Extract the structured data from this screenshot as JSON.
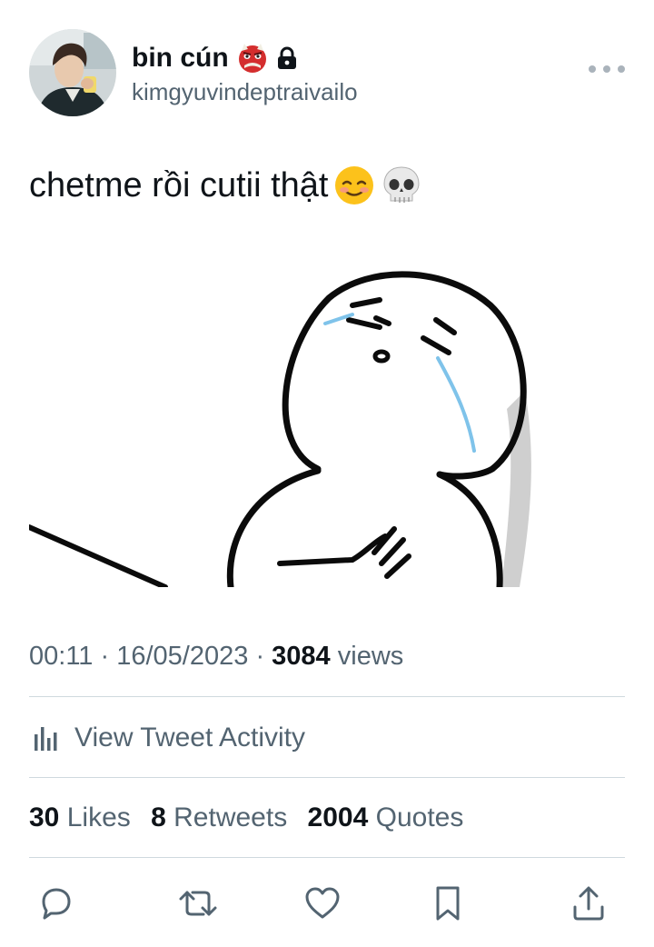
{
  "user": {
    "display_name": "bin cún",
    "handle": "kimgyuvindeptraivailo",
    "badge_icon": "ogre-emoji-icon",
    "protected_icon": "lock-icon"
  },
  "tweet": {
    "text": "chetme rồi cutii thật",
    "emojis": [
      "smiling-face-icon",
      "skull-icon"
    ]
  },
  "meta": {
    "time": "00:11",
    "separator": "·",
    "date": "16/05/2023",
    "views_count": "3084",
    "views_label": "views"
  },
  "activity": {
    "label": "View Tweet Activity"
  },
  "stats": {
    "likes_count": "30",
    "likes_label": "Likes",
    "retweets_count": "8",
    "retweets_label": "Retweets",
    "quotes_count": "2004",
    "quotes_label": "Quotes"
  },
  "actions": [
    "reply-icon",
    "retweet-icon",
    "like-icon",
    "bookmark-icon",
    "share-icon"
  ],
  "colors": {
    "text_primary": "#0f1419",
    "text_secondary": "#536471",
    "divider": "#cfd9de",
    "icon": "#536471"
  }
}
